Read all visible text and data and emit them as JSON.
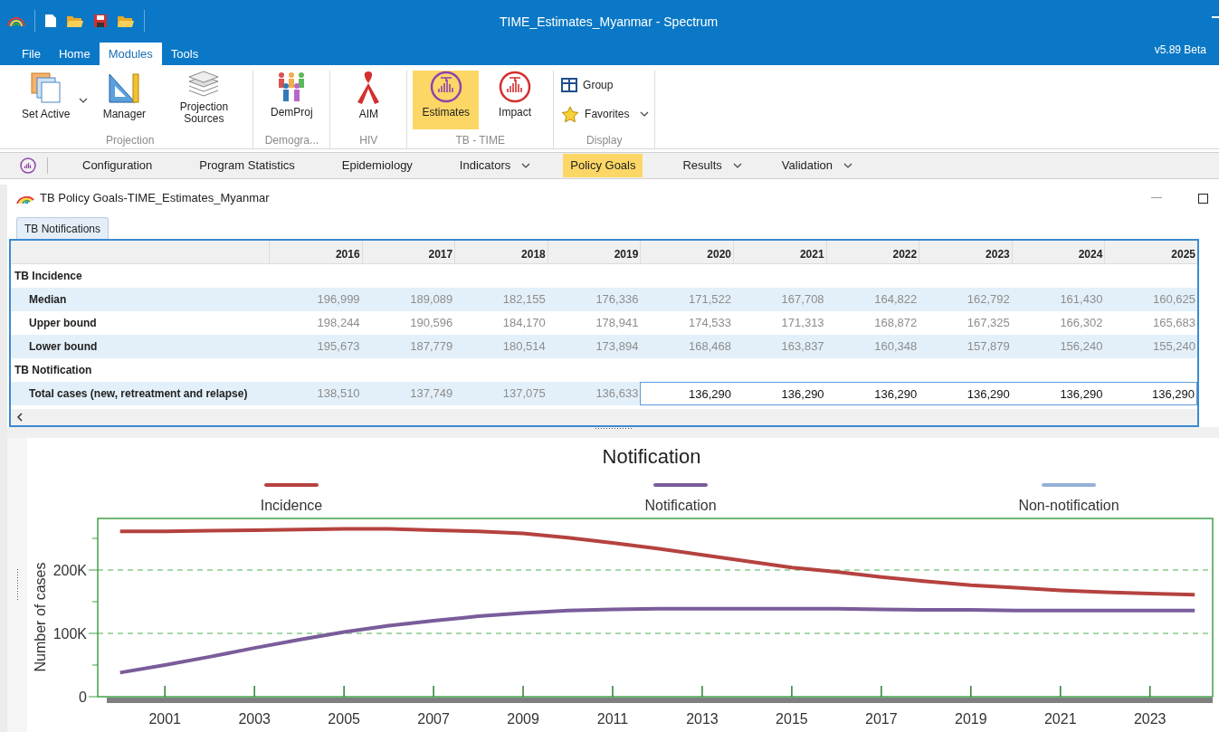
{
  "app": {
    "title": "TIME_Estimates_Myanmar - Spectrum",
    "version": "v5.89 Beta"
  },
  "menu_tabs": [
    {
      "label": "File",
      "selected": false
    },
    {
      "label": "Home",
      "selected": false
    },
    {
      "label": "Modules",
      "selected": true
    },
    {
      "label": "Tools",
      "selected": false
    }
  ],
  "ribbon_groups": [
    {
      "label": "Projection",
      "buttons": [
        {
          "kind": "large",
          "label": "Set Active",
          "dropdown": true,
          "selected": false
        },
        {
          "kind": "large",
          "label": "Manager",
          "dropdown": false,
          "selected": false
        },
        {
          "kind": "large",
          "label": "Projection Sources",
          "dropdown": false,
          "selected": false
        }
      ]
    },
    {
      "label": "Demogra...",
      "buttons": [
        {
          "kind": "large",
          "label": "DemProj",
          "dropdown": false,
          "selected": false
        }
      ]
    },
    {
      "label": "HIV",
      "buttons": [
        {
          "kind": "large",
          "label": "AIM",
          "dropdown": false,
          "selected": false
        }
      ]
    },
    {
      "label": "TB - TIME",
      "buttons": [
        {
          "kind": "large",
          "label": "Estimates",
          "dropdown": false,
          "selected": true
        },
        {
          "kind": "large",
          "label": "Impact",
          "dropdown": false,
          "selected": false
        }
      ]
    },
    {
      "label": "Display",
      "buttons": [
        {
          "kind": "small",
          "label": "Group",
          "dropdown": false,
          "selected": false
        },
        {
          "kind": "small",
          "label": "Favorites",
          "dropdown": true,
          "selected": false
        }
      ]
    }
  ],
  "subnav": [
    {
      "label": "Configuration",
      "dropdown": false,
      "selected": false
    },
    {
      "label": "Program Statistics",
      "dropdown": false,
      "selected": false
    },
    {
      "label": "Epidemiology",
      "dropdown": false,
      "selected": false
    },
    {
      "label": "Indicators",
      "dropdown": true,
      "selected": false
    },
    {
      "label": "Policy Goals",
      "dropdown": false,
      "selected": true
    },
    {
      "label": "Results",
      "dropdown": true,
      "selected": false
    },
    {
      "label": "Validation",
      "dropdown": true,
      "selected": false
    }
  ],
  "document": {
    "title": "TB Policy Goals-TIME_Estimates_Myanmar",
    "tabs": [
      {
        "label": "TB Notifications",
        "selected": true
      }
    ],
    "table": {
      "columns": [
        "2016",
        "2017",
        "2018",
        "2019",
        "2020",
        "2021",
        "2022",
        "2023",
        "2024",
        "2025"
      ],
      "rows": [
        {
          "kind": "group",
          "label": "TB Incidence"
        },
        {
          "kind": "data",
          "label": "Median",
          "cells": [
            "196,999",
            "189,089",
            "182,155",
            "176,336",
            "171,522",
            "167,708",
            "164,822",
            "162,792",
            "161,430",
            "160,625"
          ]
        },
        {
          "kind": "data",
          "label": "Upper bound",
          "cells": [
            "198,244",
            "190,596",
            "184,170",
            "178,941",
            "174,533",
            "171,313",
            "168,872",
            "167,325",
            "166,302",
            "165,683"
          ]
        },
        {
          "kind": "data",
          "label": "Lower bound",
          "cells": [
            "195,673",
            "187,779",
            "180,514",
            "173,894",
            "168,468",
            "163,837",
            "160,348",
            "157,879",
            "156,240",
            "155,240"
          ]
        },
        {
          "kind": "group",
          "label": "TB Notification"
        },
        {
          "kind": "data",
          "label": "Total cases (new, retreatment and relapse)",
          "cells": [
            {
              "text": "138,510",
              "editable": false
            },
            {
              "text": "137,749",
              "editable": false
            },
            {
              "text": "137,075",
              "editable": false
            },
            {
              "text": "136,633",
              "editable": false
            },
            {
              "text": "136,290",
              "editable": true
            },
            {
              "text": "136,290",
              "editable": true
            },
            {
              "text": "136,290",
              "editable": true
            },
            {
              "text": "136,290",
              "editable": true
            },
            {
              "text": "136,290",
              "editable": true
            },
            {
              "text": "136,290",
              "editable": true
            }
          ]
        }
      ]
    },
    "chart": {
      "chart_data": {
        "type": "line",
        "title": "Notification",
        "ylabel": "Number of cases",
        "x": [
          2000,
          2001,
          2002,
          2003,
          2004,
          2005,
          2006,
          2007,
          2008,
          2009,
          2010,
          2011,
          2012,
          2013,
          2014,
          2015,
          2016,
          2017,
          2018,
          2019,
          2020,
          2021,
          2022,
          2023,
          2024
        ],
        "series": [
          {
            "name": "Incidence",
            "color": "#b5423f",
            "values": [
              261000,
              261000,
              262000,
              263000,
              264000,
              265000,
              265000,
              263000,
              261000,
              258000,
              251000,
              243000,
              234000,
              224000,
              214000,
              204000,
              197000,
              189000,
              182000,
              176000,
              172000,
              168000,
              165000,
              163000,
              161000
            ]
          },
          {
            "name": "Notification",
            "color": "#7a5c9a",
            "values": [
              38000,
              50000,
              63000,
              77000,
              90000,
              102000,
              112000,
              120000,
              127000,
              132000,
              136000,
              138000,
              139000,
              139000,
              139000,
              139000,
              139000,
              138000,
              137000,
              137000,
              136000,
              136000,
              136000,
              136000,
              136000
            ]
          },
          {
            "name": "Non-notification",
            "color": "#94b0d6",
            "values": [
              null,
              null,
              null,
              null,
              null,
              null,
              null,
              null,
              null,
              null,
              null,
              null,
              null,
              null,
              null,
              null,
              null,
              null,
              null,
              null,
              null,
              null,
              null,
              null,
              null
            ]
          }
        ],
        "legend": true,
        "xlim": [
          1999.5,
          2024.4
        ],
        "ylim": [
          0,
          280000
        ],
        "xticks": [
          {
            "value": 2001,
            "label": "2001"
          },
          {
            "value": 2003,
            "label": "2003"
          },
          {
            "value": 2005,
            "label": "2005"
          },
          {
            "value": 2007,
            "label": "2007"
          },
          {
            "value": 2009,
            "label": "2009"
          },
          {
            "value": 2011,
            "label": "2011"
          },
          {
            "value": 2013,
            "label": "2013"
          },
          {
            "value": 2015,
            "label": "2015"
          },
          {
            "value": 2017,
            "label": "2017"
          },
          {
            "value": 2019,
            "label": "2019"
          },
          {
            "value": 2021,
            "label": "2021"
          },
          {
            "value": 2023,
            "label": "2023"
          }
        ],
        "yticks": [
          0,
          {
            "value": 100000,
            "label": "100K"
          },
          {
            "value": 200000,
            "label": "200K"
          }
        ]
      }
    }
  }
}
